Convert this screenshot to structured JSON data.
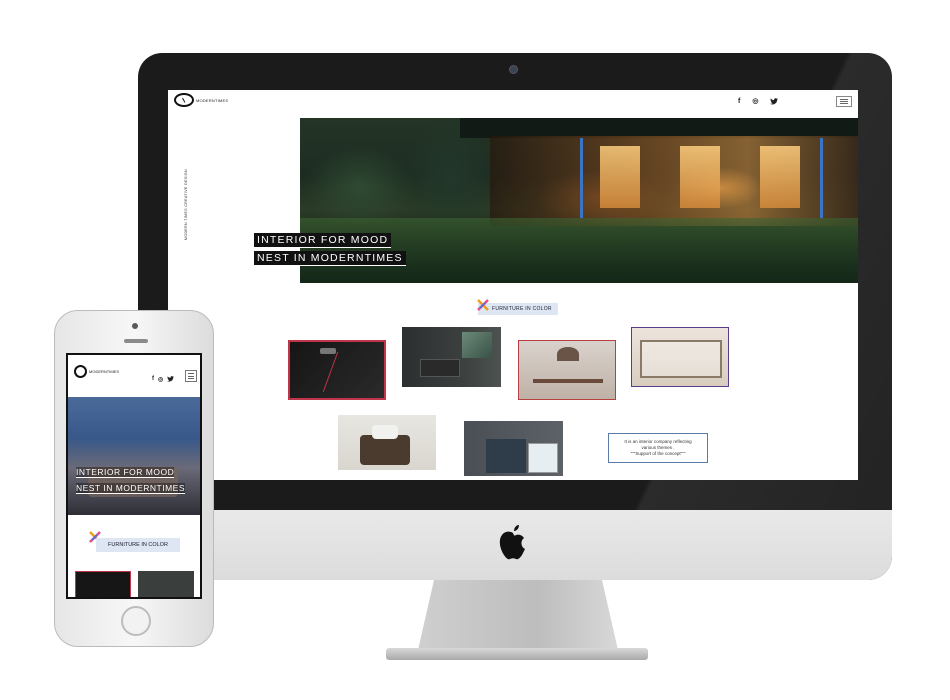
{
  "desktop": {
    "brand": {
      "name": "MODERNTIMES"
    },
    "social": {
      "facebook": "f",
      "instagram": "◎",
      "twitter": "🐦"
    },
    "vertical_tagline": "MODERN TIMES CREATIVE DESIGN",
    "hero": {
      "line1": "INTERIOR FOR MOOD",
      "line2": "NEST IN MODERNTIMES"
    },
    "section_title": "FURNITURE IN COLOR",
    "info_text": {
      "line1": "It is an interior company reflecting",
      "line2": "various themes .",
      "line3": "\"\"\"Support of the concept\"\"\""
    }
  },
  "mobile": {
    "brand": {
      "name": "MODERNTIMES"
    },
    "social": {
      "facebook": "f",
      "instagram": "◎",
      "twitter": "🐦"
    },
    "hero": {
      "line1": "INTERIOR FOR MOOD",
      "line2": "NEST IN MODERNTIMES"
    },
    "section_title": "FURNITURE IN COLOR"
  },
  "colors": {
    "accent_red": "#c0354a",
    "chip_bg": "#dde6f2",
    "hero_dark": "#1d2c22"
  },
  "icons": [
    "camera-icon",
    "apple-logo-icon",
    "facebook-icon",
    "instagram-icon",
    "twitter-icon",
    "hamburger-menu-icon",
    "colorful-x-icon"
  ]
}
